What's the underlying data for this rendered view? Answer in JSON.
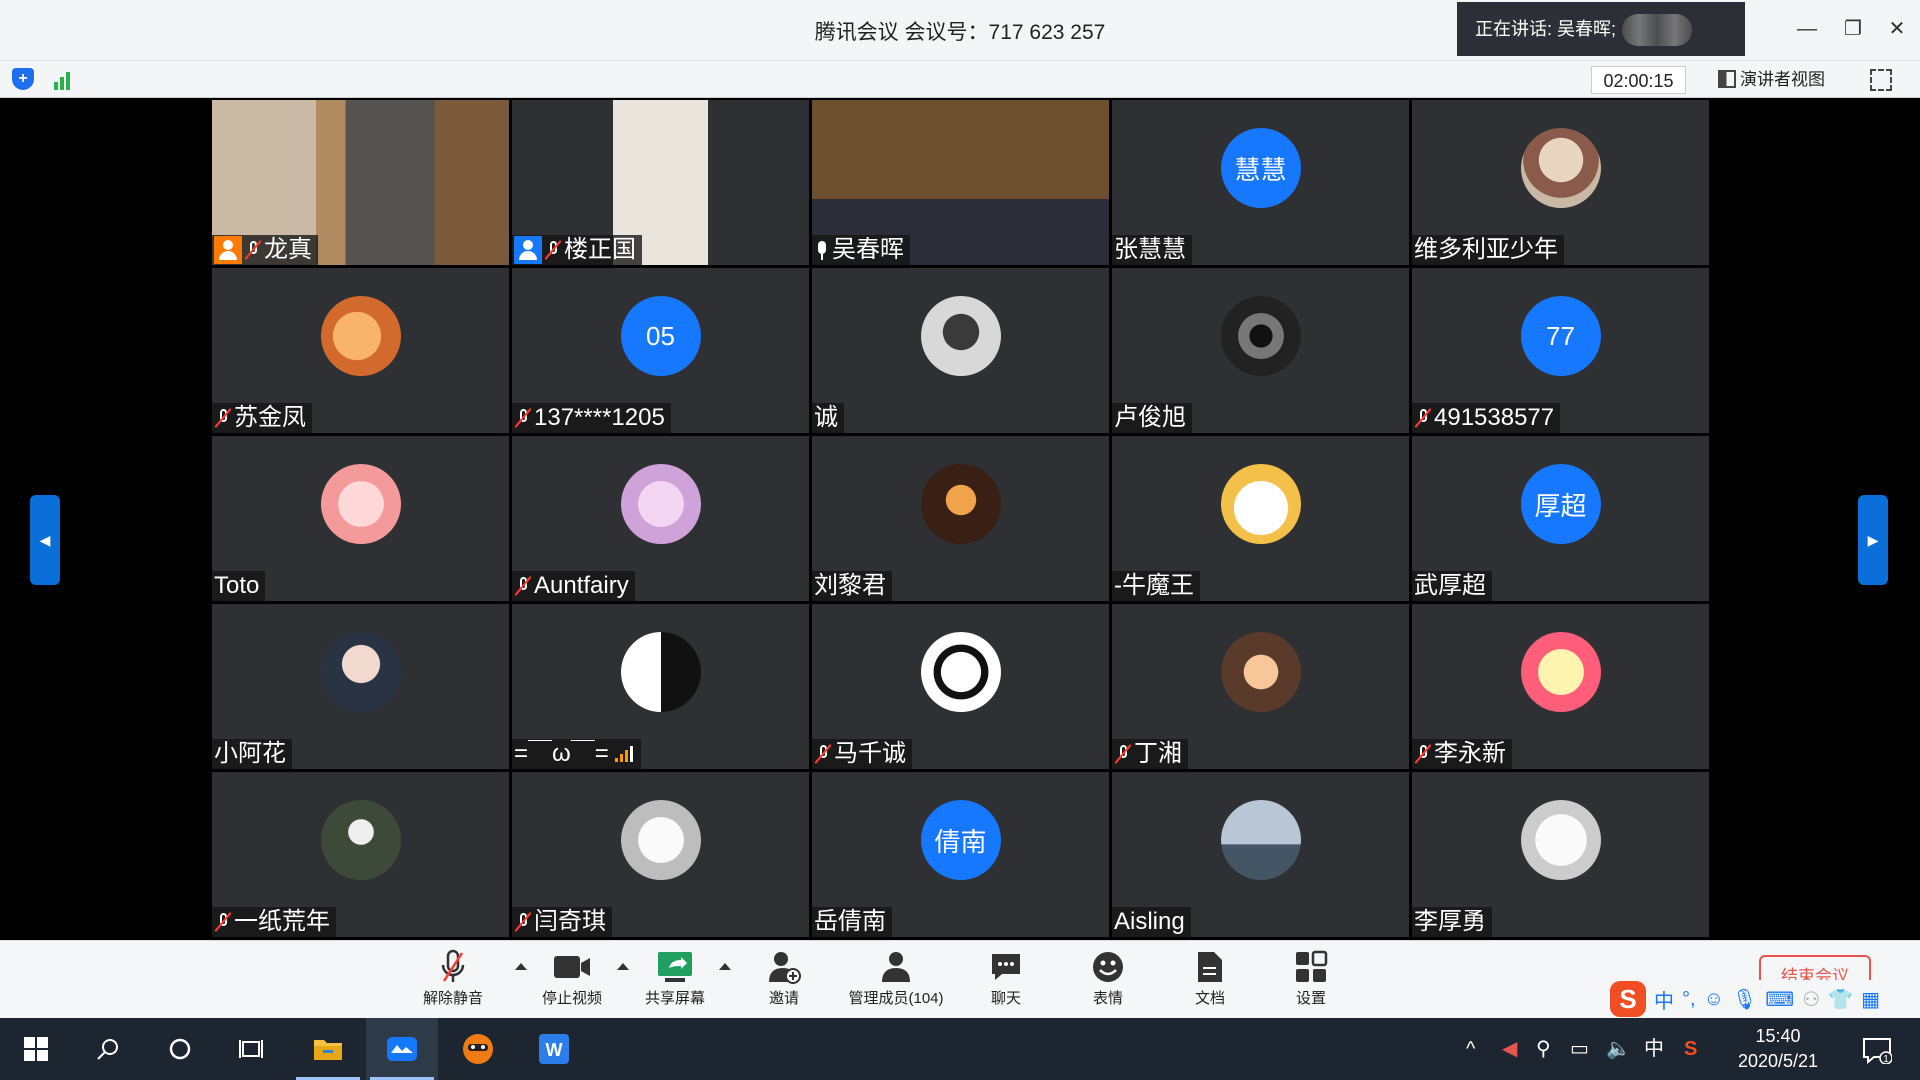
{
  "window": {
    "title": "腾讯会议 会议号：717 623 257",
    "speaking_label": "正在讲话: 吴春晖;",
    "timer": "02:00:15",
    "presenter_view": "演讲者视图"
  },
  "participants": [
    {
      "name": "龙真",
      "type": "video",
      "muted": true,
      "host": "orange"
    },
    {
      "name": "楼正国",
      "type": "video",
      "muted": true,
      "host": "blue"
    },
    {
      "name": "吴春晖",
      "type": "video",
      "muted": false,
      "speaking": true
    },
    {
      "name": "张慧慧",
      "type": "text",
      "avatar_text": "慧慧",
      "muted": false
    },
    {
      "name": "维多利亚少年",
      "type": "image",
      "muted": false
    },
    {
      "name": "苏金凤",
      "type": "image",
      "muted": true
    },
    {
      "name": "137****1205",
      "type": "text",
      "avatar_text": "05",
      "muted": true
    },
    {
      "name": "诚",
      "type": "image",
      "muted": false
    },
    {
      "name": "卢俊旭",
      "type": "image",
      "muted": false
    },
    {
      "name": "491538577",
      "type": "text",
      "avatar_text": "77",
      "muted": true
    },
    {
      "name": "Toto",
      "type": "image",
      "muted": false
    },
    {
      "name": "Auntfairy",
      "type": "image",
      "muted": true
    },
    {
      "name": "刘黎君",
      "type": "image",
      "muted": false
    },
    {
      "name": "-牛魔王",
      "type": "image",
      "muted": false
    },
    {
      "name": "武厚超",
      "type": "text",
      "avatar_text": "厚超",
      "muted": false
    },
    {
      "name": "小阿花",
      "type": "image",
      "muted": false
    },
    {
      "name": "=￣ω￣=",
      "type": "image",
      "muted": false,
      "signal": true
    },
    {
      "name": "马千诚",
      "type": "image",
      "muted": true
    },
    {
      "name": "丁湘",
      "type": "image",
      "muted": true
    },
    {
      "name": "李永新",
      "type": "image",
      "muted": true
    },
    {
      "name": "一纸荒年",
      "type": "image",
      "muted": true
    },
    {
      "name": "闫奇琪",
      "type": "image",
      "muted": true
    },
    {
      "name": "岳倩南",
      "type": "text",
      "avatar_text": "倩南",
      "muted": false
    },
    {
      "name": "Aisling",
      "type": "image",
      "muted": false
    },
    {
      "name": "李厚勇",
      "type": "image",
      "muted": false
    }
  ],
  "toolbar": {
    "unmute": "解除静音",
    "stop_video": "停止视频",
    "share_screen": "共享屏幕",
    "invite": "邀请",
    "manage_members": "管理成员(104)",
    "chat": "聊天",
    "emoji": "表情",
    "docs": "文档",
    "settings": "设置",
    "end_meeting": "结束会议"
  },
  "ime": {
    "lang": "中"
  },
  "taskbar": {
    "tray_lang": "中",
    "time": "15:40",
    "date": "2020/5/21",
    "notifications": "1"
  },
  "colors": {
    "accent": "#1677ff",
    "speaking_border": "#2dd36f",
    "mute_red": "#ff3b30"
  }
}
